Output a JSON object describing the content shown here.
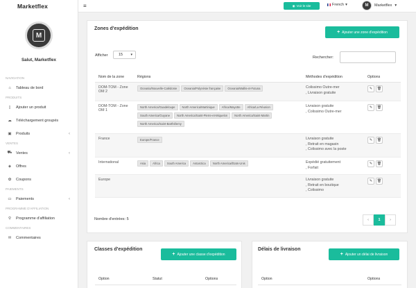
{
  "brand": "Marketflex",
  "sidebar": {
    "greeting": "Salut, Marketflex",
    "sections": {
      "navigation": "NAVIGATION",
      "produits": "PRODUITS",
      "ventes": "VENTES",
      "paiments": "PAIEMENTS",
      "affiliation": "PROGRAMME D'AFFILIATION",
      "commentaires": "COMMENTAIRES"
    },
    "items": {
      "dashboard": "Tableau de bord",
      "add_product": "Ajouter un produit",
      "bulk_upload": "Téléchargement groupés",
      "products": "Produits",
      "sales": "Ventes",
      "offers": "Offres",
      "coupons": "Coupons",
      "payments": "Paiements",
      "affiliate": "Programme d'affiliation",
      "comments": "Commentaires"
    }
  },
  "topbar": {
    "visit_site": "Voir le site",
    "language": "French",
    "user": "Marketflex"
  },
  "zones": {
    "title": "Zones d'expédition",
    "add_button": "Ajouter une zone d'expédition",
    "show_label": "Afficher",
    "page_size": "15",
    "search_label": "Rechercher:",
    "columns": {
      "name": "Nom de la zone",
      "regions": "Régions",
      "methods": "Méthodes d'expédition",
      "options": "Options"
    },
    "rows": [
      {
        "name": "DOM-TOM - Zone OM 2",
        "regions": [
          "Oceania/Nouvelle-Calédonie",
          "Oceania/Polynésie française",
          "Oceania/Wallis-et-Futuna"
        ],
        "methods": [
          "Colissimo Outre-mer",
          ", Livraison gratuite"
        ]
      },
      {
        "name": "DOM-TOM - Zone OM 1",
        "regions": [
          "North America/Guadeloupe",
          "North America/Martinique",
          "Africa/Mayotte",
          "Africa/La Réunion",
          "South America/Guyane",
          "North America/Saint-Pierre-et-Miquelon",
          "North America/Saint-Martin",
          "North America/Saint-Barthélemy"
        ],
        "methods": [
          "Livraison gratuite",
          ", Colissimo Outre-mer"
        ]
      },
      {
        "name": "France",
        "regions": [
          "Europe/France"
        ],
        "methods": [
          "Livraison gratuite",
          ", Retrait en magasin",
          ", Colissimo avec la poste"
        ]
      },
      {
        "name": "International",
        "regions": [
          "Asia",
          "Africa",
          "South America",
          "Antarctica",
          "North America/États-Unis"
        ],
        "methods": [
          "Expédié gratuitement",
          ", Forfait"
        ]
      },
      {
        "name": "Europe",
        "regions": [],
        "methods": [
          "Livraison gratuite",
          ", Retrait en boutique",
          ", Colissimo"
        ]
      }
    ],
    "entries_info": "Nombre d'entrées: 5",
    "pagination": {
      "prev": "‹",
      "current": "1",
      "next": "›"
    }
  },
  "classes": {
    "title": "Classes d'expédition",
    "add_button": "Ajouter une classe d'expédition",
    "columns": {
      "option": "Option",
      "status": "Statut",
      "options": "Options"
    }
  },
  "delays": {
    "title": "Délais de livraison",
    "add_button": "Ajouter un délai de livraison",
    "columns": {
      "option": "Option",
      "options": "Options"
    }
  },
  "colors": {
    "accent": "#1abc9c"
  }
}
